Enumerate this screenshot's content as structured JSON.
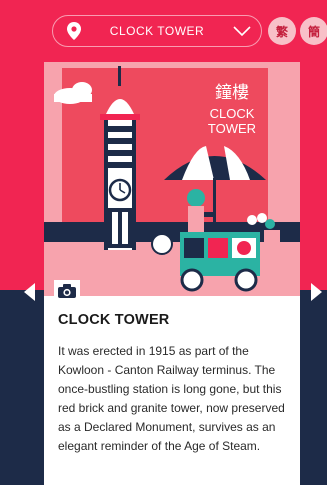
{
  "header": {
    "location": "CLOCK TOWER",
    "lang_traditional": "繁",
    "lang_simplified": "簡"
  },
  "illustration": {
    "title_chinese": "鐘樓",
    "title_line1": "CLOCK",
    "title_line2": "TOWER"
  },
  "place": {
    "title": "CLOCK TOWER",
    "description": "It was erected in 1915 as part of the Kowloon - Canton Railway terminus. The once-bustling station is long gone, but this red brick and granite tower, now preserved as a Declared Monument, survives as an elegant reminder of the Age of Steam."
  },
  "icons": {
    "location": "map-pin-icon",
    "dropdown": "chevron-down-icon",
    "photo": "camera-icon",
    "prev": "chevron-left-icon",
    "next": "chevron-right-icon"
  },
  "colors": {
    "brand_red": "#f12552",
    "navy": "#1d2b48",
    "pink_bg": "#f7a3ad",
    "teal": "#2bb3a3"
  }
}
